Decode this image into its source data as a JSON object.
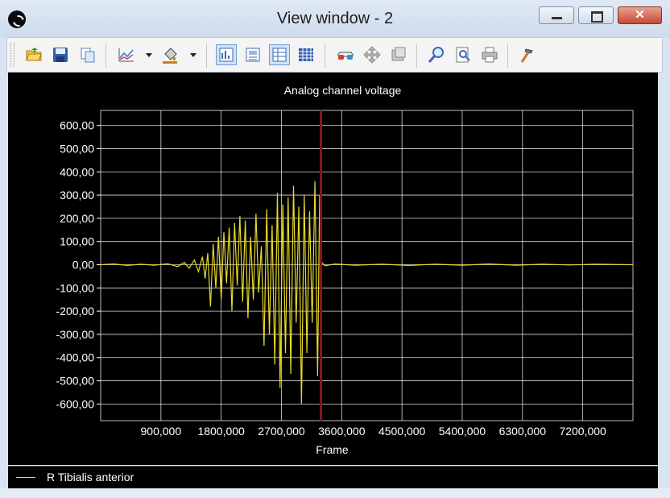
{
  "window": {
    "title": "View window - 2"
  },
  "toolbar": {
    "buttons": [
      "open-icon",
      "save-icon",
      "copy-icon",
      "chart-type-icon",
      "fill-color-icon",
      "layout-1-icon",
      "layout-2-icon",
      "layout-3-icon",
      "table-icon",
      "glasses-icon",
      "move-icon",
      "screen-icon",
      "zoom-icon",
      "page-zoom-icon",
      "print-icon",
      "hammer-icon"
    ]
  },
  "colors": {
    "signal": "#e8da29",
    "cursor": "#8e1414",
    "grid": "#ffffff",
    "background": "#000000",
    "text": "#ffffff"
  },
  "chart_data": {
    "type": "line",
    "title": "Analog channel voltage",
    "xlabel": "Frame",
    "ylabel": "",
    "xlim": [
      0,
      7950
    ],
    "ylim": [
      -630,
      630
    ],
    "xticks": [
      900,
      1800,
      2700,
      3600,
      4500,
      5400,
      6300,
      7200
    ],
    "xtick_labels": [
      "900,000",
      "1800,000",
      "2700,000",
      "3600,000",
      "4500,000",
      "5400,000",
      "6300,000",
      "7200,000"
    ],
    "yticks": [
      600,
      500,
      400,
      300,
      200,
      100,
      0,
      -100,
      -200,
      -300,
      -400,
      -500,
      -600
    ],
    "ytick_labels": [
      "600,00",
      "500,00",
      "400,00",
      "300,00",
      "200,00",
      "100,00",
      "0,00",
      "-100,00",
      "-200,00",
      "-300,00",
      "-400,00",
      "-500,00",
      "-600,00"
    ],
    "grid": true,
    "cursor_x": 3290,
    "series": [
      {
        "name": "R Tibialis anterior",
        "x": [
          0,
          200,
          400,
          600,
          800,
          1000,
          1150,
          1250,
          1320,
          1400,
          1460,
          1520,
          1560,
          1600,
          1640,
          1680,
          1720,
          1760,
          1800,
          1840,
          1880,
          1920,
          1960,
          2000,
          2040,
          2080,
          2120,
          2160,
          2200,
          2240,
          2280,
          2320,
          2360,
          2400,
          2440,
          2480,
          2520,
          2560,
          2600,
          2640,
          2680,
          2720,
          2760,
          2800,
          2840,
          2880,
          2920,
          2960,
          3000,
          3040,
          3080,
          3120,
          3160,
          3200,
          3240,
          3270,
          3300,
          3350,
          3500,
          3800,
          4200,
          4600,
          5000,
          5400,
          5800,
          6200,
          6600,
          7000,
          7400,
          7950
        ],
        "y": [
          0,
          3,
          -3,
          2,
          -2,
          4,
          -8,
          10,
          -15,
          20,
          -30,
          35,
          -60,
          50,
          -180,
          90,
          -100,
          120,
          -150,
          140,
          -80,
          160,
          -200,
          180,
          -90,
          210,
          -160,
          190,
          -230,
          120,
          -150,
          220,
          -120,
          80,
          -350,
          240,
          -300,
          170,
          -430,
          310,
          -530,
          260,
          -380,
          290,
          -470,
          340,
          -250,
          250,
          -600,
          300,
          -380,
          230,
          -250,
          360,
          -480,
          300,
          10,
          -4,
          3,
          -2,
          2,
          -3,
          2,
          -2,
          3,
          -2,
          2,
          -1,
          2,
          0
        ]
      }
    ]
  },
  "legend": {
    "label": "R Tibialis anterior"
  }
}
